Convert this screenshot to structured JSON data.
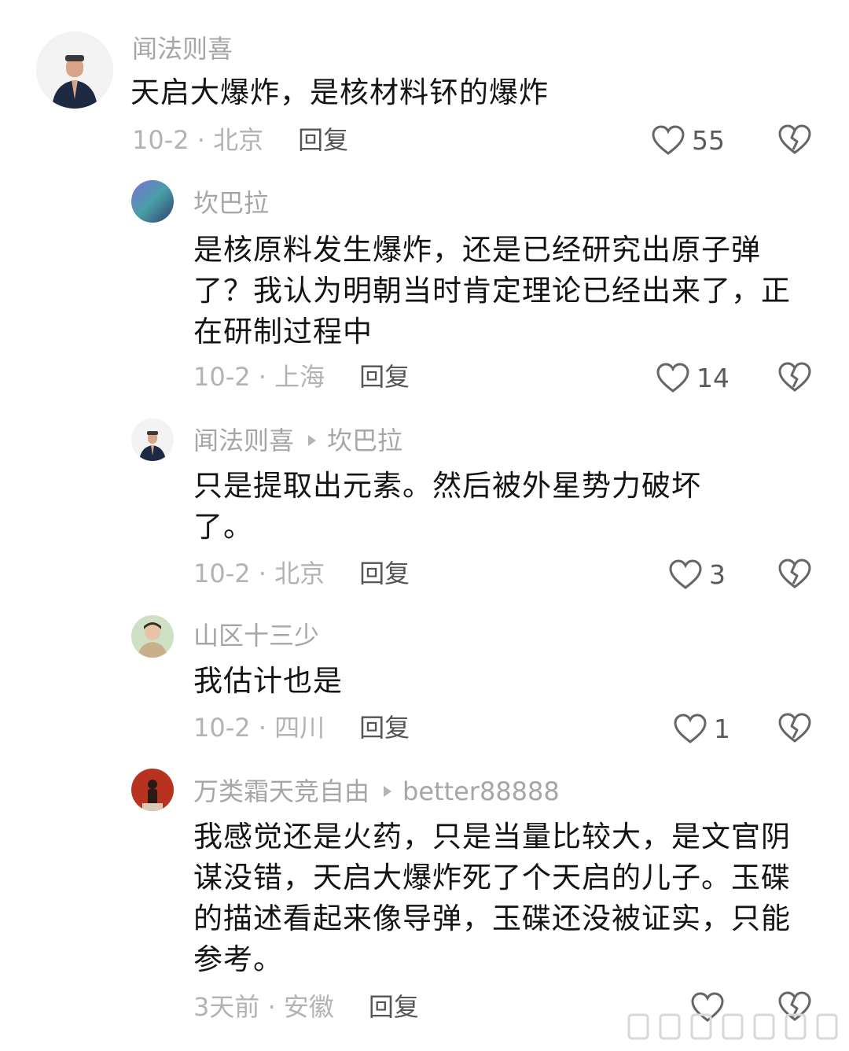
{
  "comments": [
    {
      "name": "闻法则喜",
      "text": "天启大爆炸，是核材料钚的爆炸",
      "time": "10-2 · 北京",
      "reply_label": "回复",
      "likes": "55"
    },
    {
      "name": "坎巴拉",
      "text": "是核原料发生爆炸，还是已经研究出原子弹了？我认为明朝当时肯定理论已经出来了，正在研制过程中",
      "time": "10-2 · 上海",
      "reply_label": "回复",
      "likes": "14"
    },
    {
      "name": "闻法则喜",
      "reply_to": "坎巴拉",
      "text": "只是提取出元素。然后被外星势力破坏了。",
      "time": "10-2 · 北京",
      "reply_label": "回复",
      "likes": "3"
    },
    {
      "name": "山区十三少",
      "text": "我估计也是",
      "time": "10-2 · 四川",
      "reply_label": "回复",
      "likes": "1"
    },
    {
      "name": "万类霜天竞自由",
      "reply_to": "better88888",
      "text": "我感觉还是火药，只是当量比较大，是文官阴谋没错，天启大爆炸死了个天启的儿子。玉碟的描述看起来像导弹，玉碟还没被证实，只能参考。",
      "time": "3天前 · 安徽",
      "reply_label": "回复",
      "likes": ""
    }
  ],
  "icons": {
    "like": "heart-outline-icon",
    "dislike": "broken-heart-outline-icon"
  },
  "colors": {
    "name": "#a6a6a6",
    "text": "#141414",
    "meta": "#b3b3b3",
    "reply": "#555555",
    "icon": "#666666"
  }
}
